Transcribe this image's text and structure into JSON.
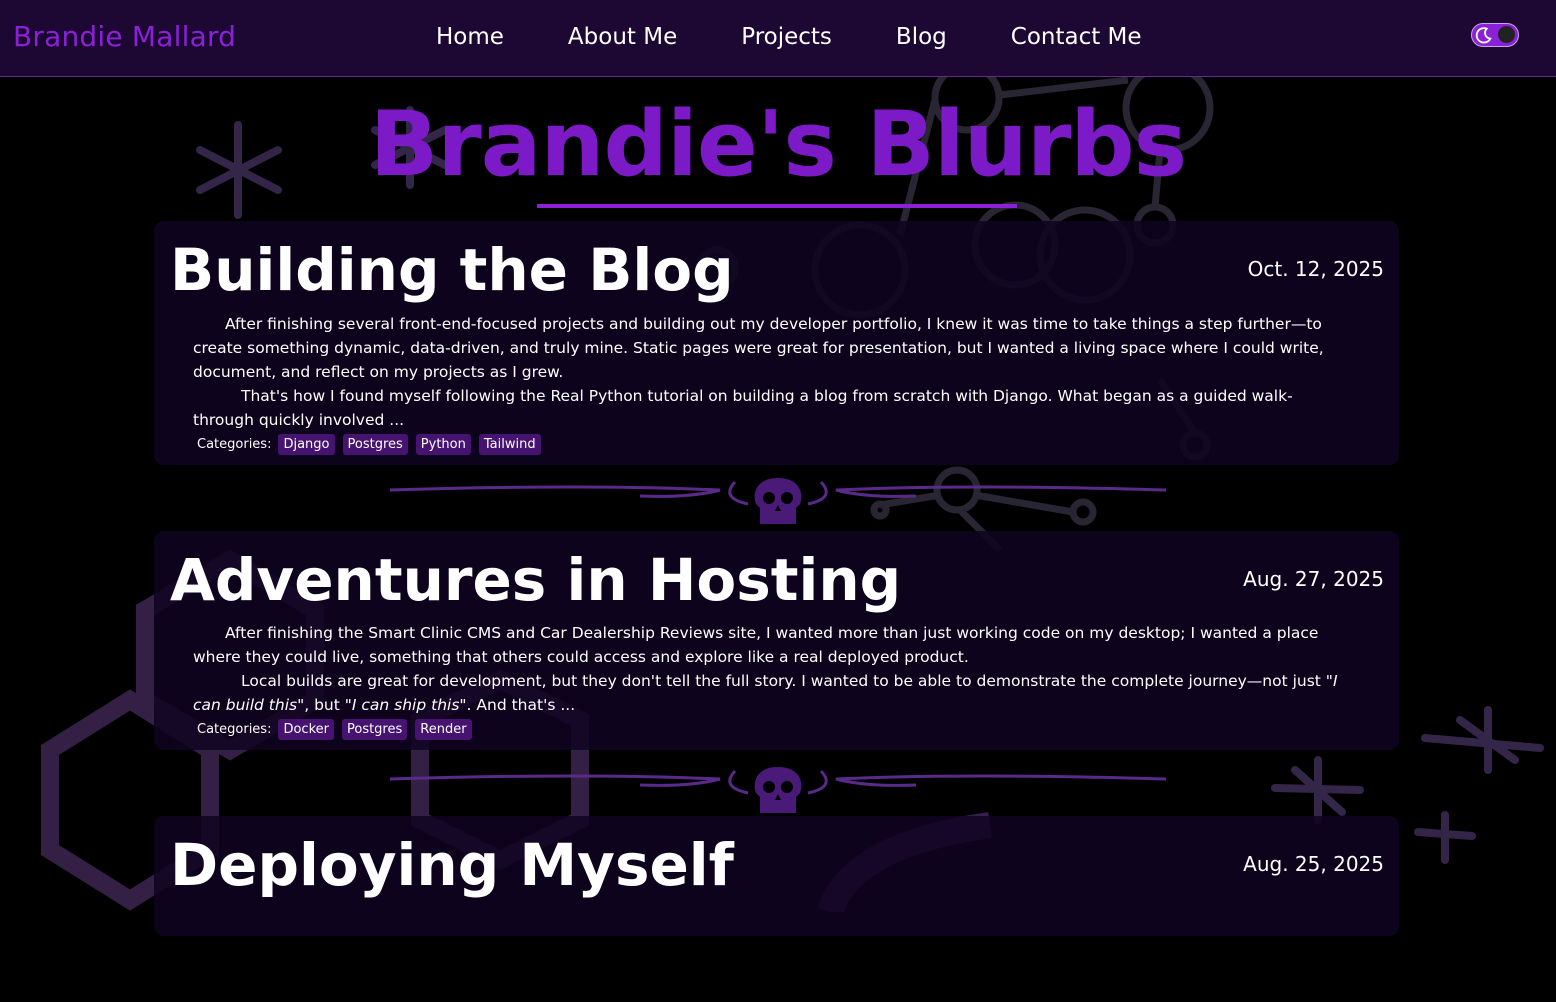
{
  "nav": {
    "brand": "Brandie Mallard",
    "links": [
      "Home",
      "About Me",
      "Projects",
      "Blog",
      "Contact Me"
    ]
  },
  "page_title": "Brandie's Blurbs",
  "categories_label": "Categories:",
  "posts": [
    {
      "title": "Building the Blog",
      "date": "Oct. 12, 2025",
      "para1": "After finishing several front-end-focused projects and building out my developer portfolio, I knew it was time to take things a step further—to create something dynamic, data-driven, and truly mine. Static pages were great for presentation, but I wanted a living space where I could write, document, and reflect on my projects as I grew.",
      "para2": "That's how I found myself following the Real Python tutorial on building a blog from scratch with Django. What began as a guided walk-through quickly involved ...",
      "tags": [
        "Django",
        "Postgres",
        "Python",
        "Tailwind"
      ]
    },
    {
      "title": "Adventures in Hosting",
      "date": "Aug. 27, 2025",
      "para1": "After finishing the Smart Clinic CMS and Car Dealership Reviews site, I wanted more than just working code on my desktop; I wanted a place where they could live, something that others could access and explore like a real deployed product.",
      "para2_a": "Local builds are great for development, but they don't tell the full story. I wanted to be able to demonstrate the complete journey—not just \"",
      "para2_em1": "I can build this",
      "para2_b": "\", but \"",
      "para2_em2": "I can ship this",
      "para2_c": "\". And that's ...",
      "tags": [
        "Docker",
        "Postgres",
        "Render"
      ]
    },
    {
      "title": "Deploying Myself",
      "date": "Aug. 25, 2025"
    }
  ],
  "colors": {
    "accent": "#8a21d6",
    "nav_bg": "#1c0833",
    "tag_bg": "#461370",
    "card_bg": "#100422"
  },
  "icons": {
    "theme_toggle": "moon-icon",
    "divider": "skull-icon"
  }
}
